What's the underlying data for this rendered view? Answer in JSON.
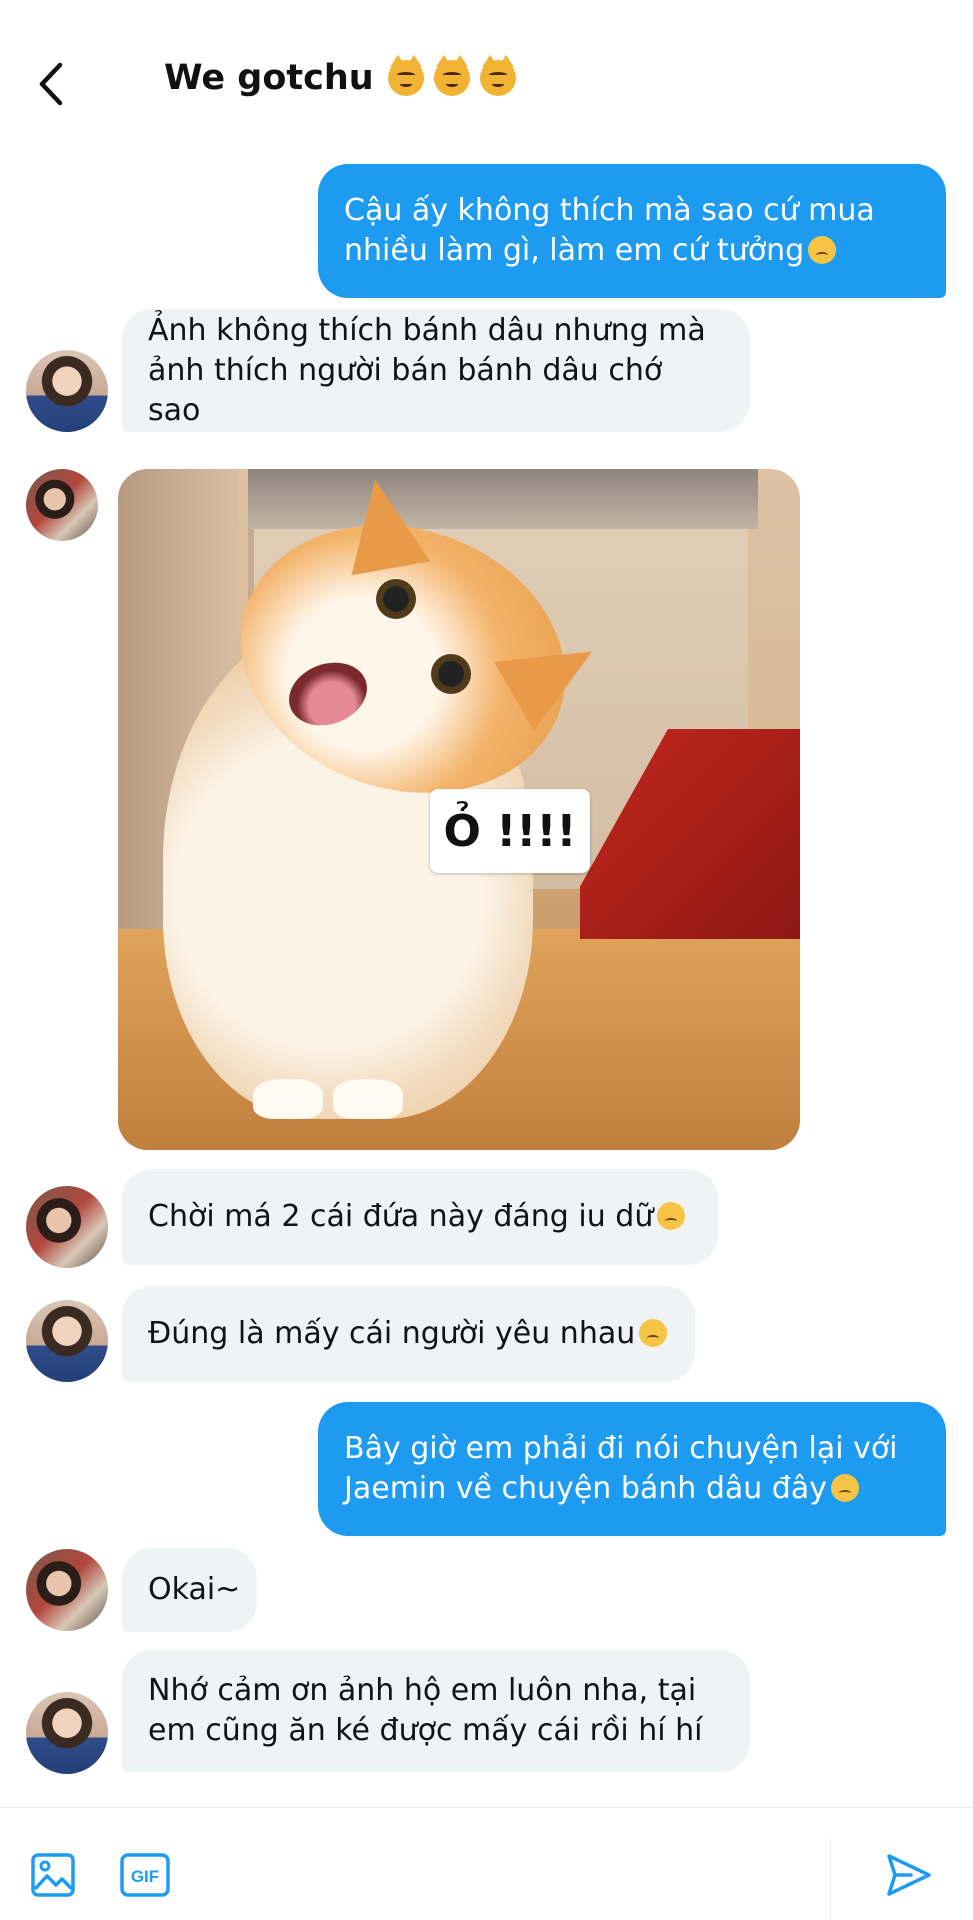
{
  "header": {
    "title": "We gotchu",
    "title_emojis": [
      "kissing-cat-emoji",
      "grinning-cat-emoji",
      "smirking-cat-emoji"
    ]
  },
  "messages": [
    {
      "direction": "outgoing",
      "text": "Cậu ấy không thích mà sao cứ mua nhiều làm gì, làm em cứ tưởng",
      "emoji": "worried-face"
    },
    {
      "direction": "incoming",
      "avatar": "a",
      "text": "Ảnh không thích bánh dâu nhưng mà ảnh thích người bán bánh dâu chớ sao"
    },
    {
      "direction": "incoming",
      "avatar": "b",
      "type": "image",
      "image_caption": "Ỏ !!!!"
    },
    {
      "direction": "incoming",
      "avatar": "b",
      "text": "Chời má 2 cái đứa này đáng iu dữ",
      "emoji": "hand-over-mouth-face"
    },
    {
      "direction": "incoming",
      "avatar": "a",
      "text": "Đúng là mấy cái người yêu nhau",
      "emoji": "kissing-closed-eyes-face"
    },
    {
      "direction": "outgoing",
      "text": "Bây giờ em phải đi nói chuyện lại với Jaemin về chuyện bánh dâu đây",
      "emoji": "pleading-face"
    },
    {
      "direction": "incoming",
      "avatar": "b",
      "text": "Okai~"
    },
    {
      "direction": "incoming",
      "avatar": "a",
      "text": "Nhớ cảm ơn ảnh hộ em luôn nha, tại em cũng ăn ké được mấy cái rồi hí hí"
    }
  ],
  "composer": {
    "image_button": "image-icon",
    "gif_label": "GIF",
    "send_button": "send-icon"
  },
  "colors": {
    "outgoing_bubble": "#1d9bf0",
    "incoming_bubble": "#eff3f4",
    "accent": "#1d9bf0"
  }
}
